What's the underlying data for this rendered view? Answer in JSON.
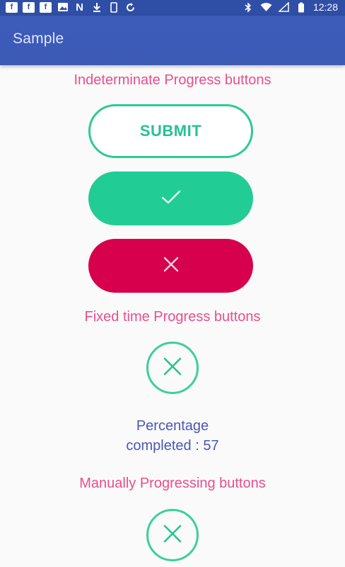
{
  "status_bar": {
    "left_icons": [
      "facebook-icon",
      "facebook-icon",
      "facebook-icon",
      "image-icon",
      "n-icon",
      "download-icon",
      "phone-icon",
      "sync-icon"
    ],
    "time": "12:28"
  },
  "app_bar": {
    "title": "Sample"
  },
  "sections": {
    "indeterminate_title": "Indeterminate Progress buttons",
    "fixed_time_title": "Fixed time Progress buttons",
    "manual_title": "Manually Progressing buttons"
  },
  "buttons": {
    "submit_label": "SUBMIT",
    "success_icon": "check-icon",
    "error_icon": "close-icon"
  },
  "percentage": {
    "line1": "Percentage",
    "line2": "completed : 57"
  },
  "colors": {
    "primary": "#3d5bb9",
    "accent_green": "#22cc95",
    "error_red": "#d6004c",
    "section_pink": "#ea4e8e",
    "percent_blue": "#4a57b8"
  }
}
